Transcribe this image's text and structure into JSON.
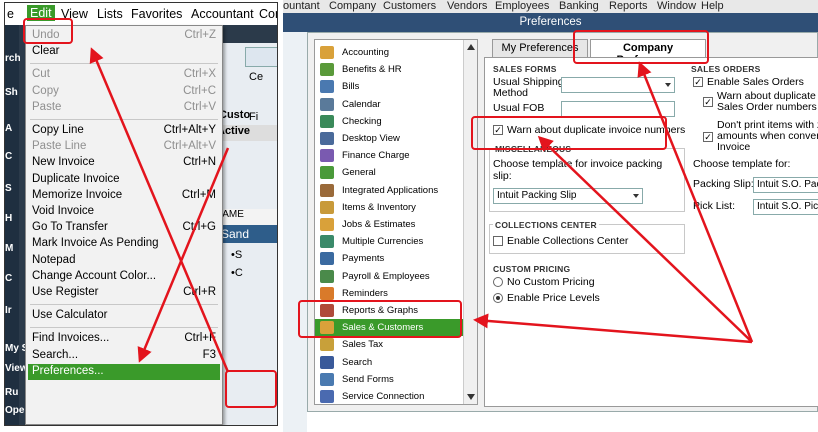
{
  "left": {
    "menubar": [
      "e",
      "Edit",
      "View",
      "Lists",
      "Favorites",
      "Accountant",
      "Com"
    ],
    "dark_nav": [
      "rch",
      "Sh",
      "A",
      "C",
      "S",
      "H",
      "M",
      "C",
      "Ir",
      "My S",
      "View",
      "Ru",
      "Open Windows"
    ],
    "bg_header_text": "Active",
    "bg_column_header": "NAME",
    "bg_customer_row": "Sand",
    "bg_list_rows": [
      "•S",
      "•C"
    ],
    "bg_tabs": [
      "Ce",
      "Fi",
      "Custo"
    ],
    "edit_menu": [
      {
        "label": "Undo",
        "shortcut": "Ctrl+Z",
        "disabled": true
      },
      {
        "label": "Clear",
        "shortcut": "",
        "disabled": false
      },
      {
        "sep": true
      },
      {
        "label": "Cut",
        "shortcut": "Ctrl+X",
        "disabled": true
      },
      {
        "label": "Copy",
        "shortcut": "Ctrl+C",
        "disabled": true
      },
      {
        "label": "Paste",
        "shortcut": "Ctrl+V",
        "disabled": true
      },
      {
        "sep": true
      },
      {
        "label": "Copy Line",
        "shortcut": "Ctrl+Alt+Y",
        "disabled": false
      },
      {
        "label": "Paste Line",
        "shortcut": "Ctrl+Alt+V",
        "disabled": true
      },
      {
        "label": "New Invoice",
        "shortcut": "Ctrl+N",
        "disabled": false
      },
      {
        "label": "Duplicate Invoice",
        "shortcut": "",
        "disabled": false
      },
      {
        "label": "Memorize Invoice",
        "shortcut": "Ctrl+M",
        "disabled": false
      },
      {
        "label": "Void Invoice",
        "shortcut": "",
        "disabled": false
      },
      {
        "label": "Go To Transfer",
        "shortcut": "Ctrl+G",
        "disabled": false
      },
      {
        "label": "Mark Invoice As Pending",
        "shortcut": "",
        "disabled": false
      },
      {
        "label": "Notepad",
        "shortcut": "",
        "disabled": false
      },
      {
        "label": "Change Account Color...",
        "shortcut": "",
        "disabled": false
      },
      {
        "label": "Use Register",
        "shortcut": "Ctrl+R",
        "disabled": false
      },
      {
        "sep": true
      },
      {
        "label": "Use Calculator",
        "shortcut": "",
        "disabled": false
      },
      {
        "sep": true
      },
      {
        "label": "Find Invoices...",
        "shortcut": "Ctrl+F",
        "disabled": false
      },
      {
        "label": "Search...",
        "shortcut": "F3",
        "disabled": false
      },
      {
        "label": "Preferences...",
        "shortcut": "",
        "disabled": false,
        "highlighted": true
      }
    ]
  },
  "right": {
    "menubar": [
      "ountant",
      "Company",
      "Customers",
      "Vendors",
      "Employees",
      "Banking",
      "Reports",
      "Window",
      "Help"
    ],
    "title": "Preferences",
    "categories": [
      {
        "label": "Accounting",
        "icon": "accounting-icon",
        "color": "#d9a13a"
      },
      {
        "label": "Benefits & HR",
        "icon": "benefits-icon",
        "color": "#5a9a3a"
      },
      {
        "label": "Bills",
        "icon": "bills-icon",
        "color": "#4a79b0"
      },
      {
        "label": "Calendar",
        "icon": "calendar-icon",
        "color": "#5a7a9a"
      },
      {
        "label": "Checking",
        "icon": "checking-icon",
        "color": "#3a8a5a"
      },
      {
        "label": "Desktop View",
        "icon": "desktop-icon",
        "color": "#4a6a9a"
      },
      {
        "label": "Finance Charge",
        "icon": "finance-charge-icon",
        "color": "#7a5ab0"
      },
      {
        "label": "General",
        "icon": "general-icon",
        "color": "#4a9a3a"
      },
      {
        "label": "Integrated Applications",
        "icon": "integrated-apps-icon",
        "color": "#9a6a3a"
      },
      {
        "label": "Items & Inventory",
        "icon": "items-inventory-icon",
        "color": "#c89a3a"
      },
      {
        "label": "Jobs & Estimates",
        "icon": "jobs-estimates-icon",
        "color": "#d9a13a"
      },
      {
        "label": "Multiple Currencies",
        "icon": "currencies-icon",
        "color": "#3a8a6a"
      },
      {
        "label": "Payments",
        "icon": "payments-icon",
        "color": "#3a6aa0"
      },
      {
        "label": "Payroll & Employees",
        "icon": "payroll-icon",
        "color": "#4a8a4a"
      },
      {
        "label": "Reminders",
        "icon": "reminders-icon",
        "color": "#d97a2a"
      },
      {
        "label": "Reports & Graphs",
        "icon": "reports-graphs-icon",
        "color": "#b04a3a"
      },
      {
        "label": "Sales & Customers",
        "icon": "sales-customers-icon",
        "color": "#d9a13a",
        "selected": true
      },
      {
        "label": "Sales Tax",
        "icon": "sales-tax-icon",
        "color": "#c8a03a"
      },
      {
        "label": "Search",
        "icon": "search-icon",
        "color": "#3a5a9a"
      },
      {
        "label": "Send Forms",
        "icon": "send-forms-icon",
        "color": "#4a7ab0"
      },
      {
        "label": "Service Connection",
        "icon": "service-connection-icon",
        "color": "#4a6ab0"
      }
    ],
    "tabs": {
      "my": "My Preferences",
      "company": "Company Preferences"
    },
    "sales_forms": {
      "heading": "SALES FORMS",
      "shipping_label": "Usual Shipping Method",
      "shipping_label_1": "Usual Shipping",
      "shipping_label_2": "Method",
      "fob_label": "Usual FOB",
      "warn_dup": "Warn about duplicate invoice numbers"
    },
    "misc": {
      "heading": "MISCELLANEOUS",
      "template_label_1": "Choose template for invoice packing",
      "template_label_2": "slip:",
      "template_value": "Intuit Packing Slip"
    },
    "collections": {
      "heading": "COLLECTIONS CENTER",
      "enable": "Enable Collections Center"
    },
    "pricing": {
      "heading": "CUSTOM PRICING",
      "no_custom": "No Custom Pricing",
      "price_levels": "Enable Price Levels"
    },
    "sales_orders": {
      "heading": "SALES ORDERS",
      "enable": "Enable Sales Orders",
      "warn_1": "Warn about duplicate",
      "warn_2": "Sales Order numbers",
      "dont_print_1": "Don't print items with zero",
      "dont_print_2": "amounts when converting to",
      "dont_print_3": "Invoice",
      "template_label": "Choose template for:",
      "packing_label": "Packing Slip:",
      "packing_value": "Intuit S.O. Packing",
      "pick_label": "Pick List:",
      "pick_value": "Intuit S.O. Pick List"
    }
  },
  "colors": {
    "highlight": "#3a9a2a",
    "annotation": "#e3141d",
    "titlebar": "#2f4f76"
  }
}
